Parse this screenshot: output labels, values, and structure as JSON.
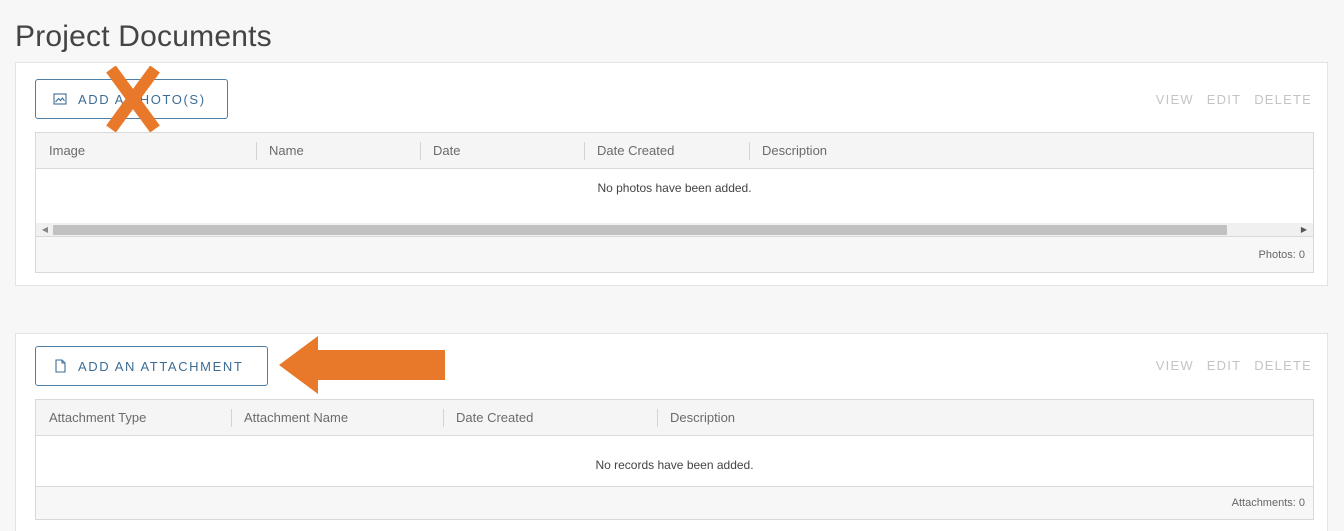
{
  "page": {
    "title": "Project Documents"
  },
  "photos": {
    "add_button_label": "ADD A PHOTO(S)",
    "add_button_icon": "image-icon",
    "actions": {
      "view": "VIEW",
      "edit": "EDIT",
      "delete": "DELETE"
    },
    "columns": [
      "Image",
      "Name",
      "Date",
      "Date Created",
      "Description"
    ],
    "empty_message": "No photos have been added.",
    "footer_count": "Photos: 0",
    "scroll_left_icon": "arrow-left-icon",
    "scroll_right_icon": "arrow-right-icon"
  },
  "attachments": {
    "add_button_label": "ADD AN ATTACHMENT",
    "add_button_icon": "document-icon",
    "actions": {
      "view": "VIEW",
      "edit": "EDIT",
      "delete": "DELETE"
    },
    "columns": [
      "Attachment Type",
      "Attachment Name",
      "Date Created",
      "Description"
    ],
    "empty_message": "No records have been added.",
    "footer_count": "Attachments: 0"
  },
  "annotations": {
    "x_mark_color": "#e8792a",
    "arrow_color": "#e8792a"
  },
  "colors": {
    "button_border": "#4d7fa6",
    "button_text": "#3d6d96",
    "disabled_action": "#c4c4c4"
  }
}
